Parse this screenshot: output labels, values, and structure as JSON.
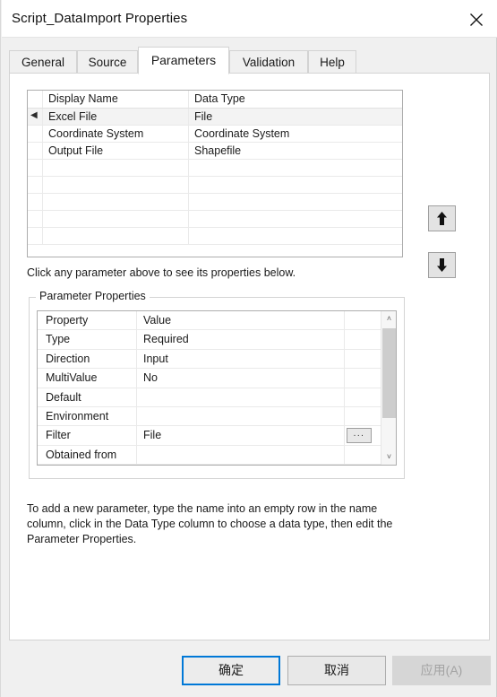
{
  "window": {
    "title": "Script_DataImport Properties",
    "close_icon": "close-icon"
  },
  "tabs": [
    {
      "label": "General",
      "active": false
    },
    {
      "label": "Source",
      "active": false
    },
    {
      "label": "Parameters",
      "active": true
    },
    {
      "label": "Validation",
      "active": false
    },
    {
      "label": "Help",
      "active": false
    }
  ],
  "parameters_grid": {
    "columns": [
      "Display Name",
      "Data Type"
    ],
    "rows": [
      {
        "selected": true,
        "marker": "◀",
        "display_name": "Excel File",
        "data_type": "File"
      },
      {
        "selected": false,
        "marker": "",
        "display_name": "Coordinate System",
        "data_type": "Coordinate System"
      },
      {
        "selected": false,
        "marker": "",
        "display_name": "Output File",
        "data_type": "Shapefile"
      },
      {
        "selected": false,
        "marker": "",
        "display_name": "",
        "data_type": ""
      },
      {
        "selected": false,
        "marker": "",
        "display_name": "",
        "data_type": ""
      },
      {
        "selected": false,
        "marker": "",
        "display_name": "",
        "data_type": ""
      },
      {
        "selected": false,
        "marker": "",
        "display_name": "",
        "data_type": ""
      },
      {
        "selected": false,
        "marker": "",
        "display_name": "",
        "data_type": ""
      }
    ]
  },
  "move_buttons": {
    "up_icon": "arrow-up-icon",
    "down_icon": "arrow-down-icon"
  },
  "hints": {
    "above_grid": "Click any parameter above to see its properties below.",
    "below_properties": "To add a new parameter, type the name into an empty row in the name column, click in the Data Type column to choose a data type, then edit the Parameter Properties."
  },
  "parameter_properties": {
    "group_title": "Parameter Properties",
    "columns": [
      "Property",
      "Value"
    ],
    "rows": [
      {
        "property": "Type",
        "value": "Required",
        "has_browse": false,
        "browse_label": ""
      },
      {
        "property": "Direction",
        "value": "Input",
        "has_browse": false,
        "browse_label": ""
      },
      {
        "property": "MultiValue",
        "value": "No",
        "has_browse": false,
        "browse_label": ""
      },
      {
        "property": "Default",
        "value": "",
        "has_browse": false,
        "browse_label": ""
      },
      {
        "property": "Environment",
        "value": "",
        "has_browse": false,
        "browse_label": ""
      },
      {
        "property": "Filter",
        "value": "File",
        "has_browse": true,
        "browse_label": "..."
      },
      {
        "property": "Obtained from",
        "value": "",
        "has_browse": false,
        "browse_label": ""
      }
    ],
    "scrollbar": {
      "up_arrow": "˄",
      "down_arrow": "˅"
    }
  },
  "dialog_buttons": {
    "ok": "确定",
    "cancel": "取消",
    "apply": "应用(A)"
  },
  "colors": {
    "accent": "#0078d7",
    "dialog_bg": "#f0f0f0",
    "panel_bg": "#ffffff",
    "selected_row": "#f3f3f3",
    "disabled_text": "#a3a3a3"
  }
}
